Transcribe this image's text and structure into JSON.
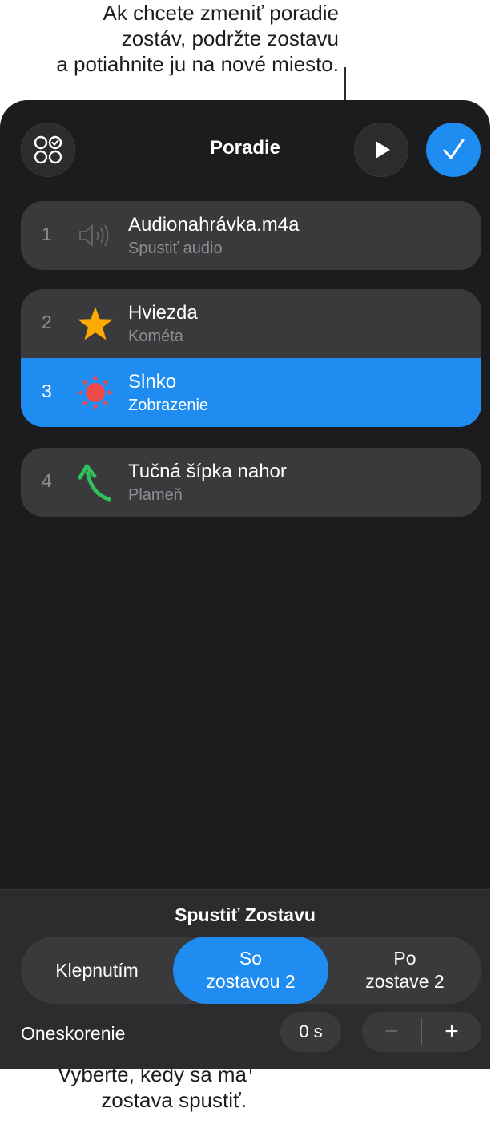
{
  "callouts": {
    "top": [
      "Ak chcete zmeniť poradie",
      "zostáv, podržte zostavu",
      "a potiahnite ju na nové miesto."
    ],
    "bottom": [
      "Vyberte, kedy sa má",
      "zostava spustiť."
    ]
  },
  "header": {
    "title": "Poradie",
    "grid_icon": "four-circles-icon",
    "play_icon": "play-icon",
    "done_icon": "checkmark-icon",
    "accent_color": "#1e8cf0"
  },
  "builds": [
    {
      "number": "1",
      "title": "Audionahrávka.m4a",
      "subtitle": "Spustiť audio",
      "icon": "speaker-icon"
    },
    {
      "number": "2",
      "title": "Hviezda",
      "subtitle": "Kométa",
      "icon": "star-icon"
    },
    {
      "number": "3",
      "title": "Slnko",
      "subtitle": "Zobrazenie",
      "icon": "sun-icon",
      "selected": true
    },
    {
      "number": "4",
      "title": "Tučná šípka nahor",
      "subtitle": "Plameň",
      "icon": "curved-arrow-icon"
    }
  ],
  "start_build": {
    "title": "Spustiť Zostavu",
    "options": [
      "Klepnutím",
      "So\nzostavou 2",
      "Po\nzostave 2"
    ],
    "selected": "So\nzostavou 2"
  },
  "delay": {
    "label": "Oneskorenie",
    "value": "0 s",
    "minus": "−",
    "plus": "+"
  }
}
